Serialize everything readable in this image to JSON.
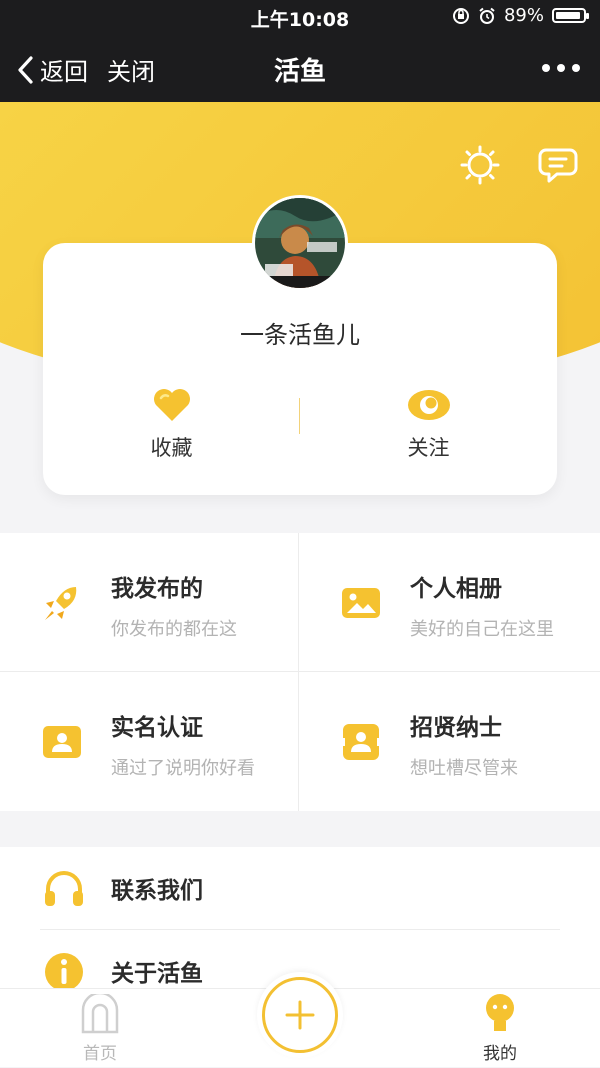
{
  "status_bar": {
    "time": "上午10:08",
    "battery": "89%"
  },
  "nav": {
    "back_label": "返回",
    "close_label": "关闭",
    "title": "活鱼"
  },
  "profile": {
    "username": "一条活鱼儿",
    "stats": [
      {
        "label": "收藏",
        "icon": "heart-icon"
      },
      {
        "label": "关注",
        "icon": "eye-icon"
      }
    ]
  },
  "grid": [
    {
      "title": "我发布的",
      "desc": "你发布的都在这",
      "icon": "rocket-icon"
    },
    {
      "title": "个人相册",
      "desc": "美好的自己在这里",
      "icon": "photo-album-icon"
    },
    {
      "title": "实名认证",
      "desc": "通过了说明你好看",
      "icon": "id-card-icon"
    },
    {
      "title": "招贤纳士",
      "desc": "想吐槽尽管来",
      "icon": "recruit-icon"
    }
  ],
  "list": [
    {
      "label": "联系我们",
      "icon": "headphones-icon"
    },
    {
      "label": "关于活鱼",
      "icon": "info-icon"
    }
  ],
  "tabbar": {
    "home": {
      "label": "首页"
    },
    "mine": {
      "label": "我的"
    }
  },
  "colors": {
    "accent": "#f3c032",
    "accent_light": "#f9dd4f",
    "nav_bg": "#1c1c1e"
  }
}
